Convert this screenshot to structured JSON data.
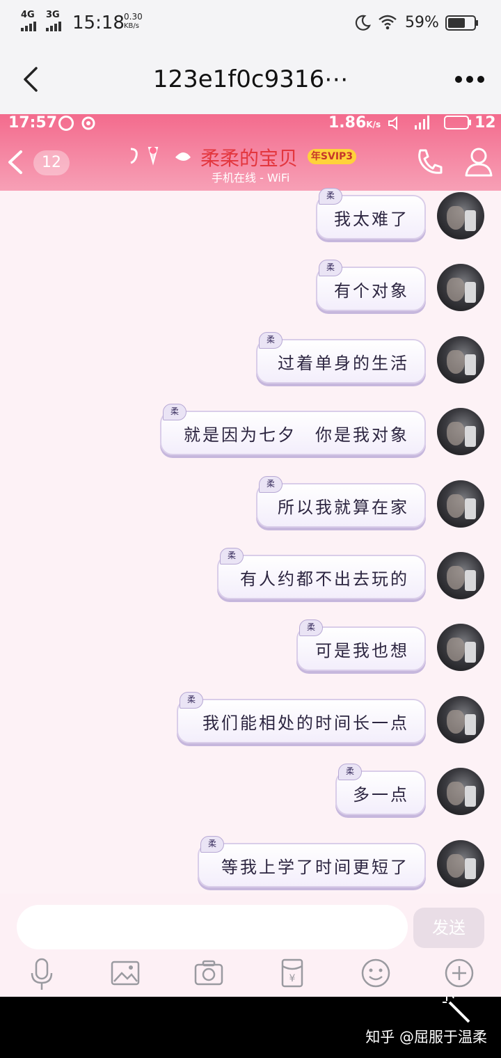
{
  "outer_status": {
    "net1": "4G",
    "net2": "3G",
    "time": "15:18",
    "speed_value": "0.30",
    "speed_unit": "KB/s",
    "battery": "59%"
  },
  "outer_nav": {
    "title": "123e1f0c9316⋯",
    "back_icon": "chevron-left-icon",
    "more_icon": "more-dots-icon"
  },
  "inner_status": {
    "time": "17:57",
    "speed": "1.86",
    "speed_unit": "K/s",
    "battery": "12"
  },
  "chat_header": {
    "unread": "12",
    "contact_name": "柔柔的宝贝",
    "vip_badge": "年SVIP3",
    "status": "手机在线 - WiFi"
  },
  "messages": [
    {
      "text": "我太难了",
      "tag": "柔"
    },
    {
      "text": "有个对象",
      "tag": "柔"
    },
    {
      "text": "过着单身的生活",
      "tag": "柔"
    },
    {
      "text": "就是因为七夕　你是我对象",
      "tag": "柔"
    },
    {
      "text": "所以我就算在家",
      "tag": "柔"
    },
    {
      "text": "有人约都不出去玩的",
      "tag": "柔"
    },
    {
      "text": "可是我也想",
      "tag": "柔"
    },
    {
      "text": "我们能相处的时间长一点",
      "tag": "柔"
    },
    {
      "text": "多一点",
      "tag": "柔"
    },
    {
      "text": "等我上学了时间更短了",
      "tag": "柔"
    }
  ],
  "input": {
    "placeholder": "",
    "send_label": "发送"
  },
  "toolbar": {
    "icons": [
      "microphone-icon",
      "image-icon",
      "camera-icon",
      "red-packet-icon",
      "emoji-icon",
      "plus-icon"
    ]
  },
  "watermark": "知乎 @屈服于温柔"
}
